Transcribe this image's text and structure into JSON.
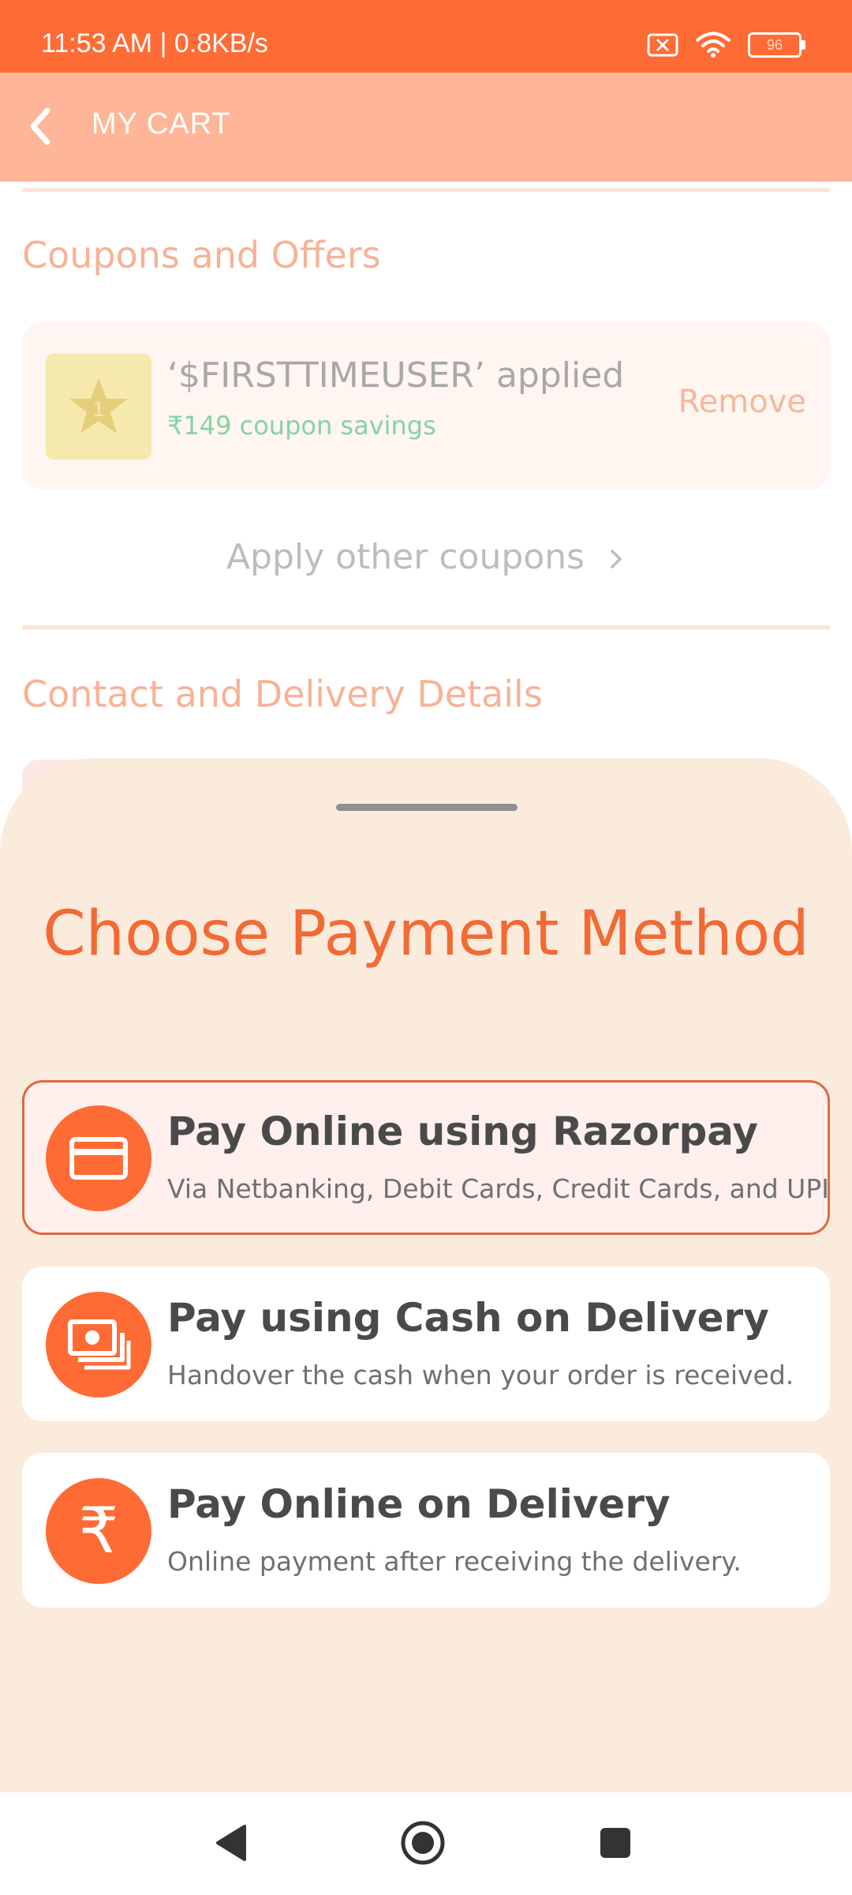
{
  "status_bar": {
    "time": "11:53 AM | 0.8KB/s",
    "battery": "96",
    "icons": [
      "close-box-icon",
      "wifi-icon",
      "battery-icon"
    ]
  },
  "app_bar": {
    "title": "MY CART",
    "back_icon": "chevron-left-icon"
  },
  "coupons": {
    "section_title": "Coupons and Offers",
    "applied": {
      "code_text": "‘$FIRSTTIMEUSER’ applied",
      "savings_text": "₹149 coupon savings",
      "remove_label": "Remove",
      "icon": "star-badge-icon",
      "badge_number": "1"
    },
    "apply_other_label": "Apply other coupons"
  },
  "contact": {
    "section_title": "Contact and Delivery Details"
  },
  "payment_sheet": {
    "title": "Choose Payment Method",
    "options": [
      {
        "title": "Pay Online using Razorpay",
        "subtitle": "Via Netbanking, Debit Cards, Credit Cards, and UPI",
        "icon": "credit-card-icon",
        "selected": true
      },
      {
        "title": "Pay using Cash on Delivery",
        "subtitle": "Handover the cash when your order is received.",
        "icon": "cash-icon",
        "selected": false
      },
      {
        "title": "Pay Online on Delivery",
        "subtitle": "Online payment after receiving the delivery.",
        "icon": "rupee-icon",
        "rupee_symbol": "₹",
        "selected": false
      }
    ]
  },
  "colors": {
    "status_bar": "#ff6b35",
    "app_bar": "#ffb597",
    "accent": "#f26a34",
    "sheet_bg": "#fbebdd",
    "savings_green": "#86d3a3"
  },
  "nav_bar": {
    "icons": [
      "back-triangle-icon",
      "home-circle-icon",
      "recents-square-icon"
    ]
  }
}
